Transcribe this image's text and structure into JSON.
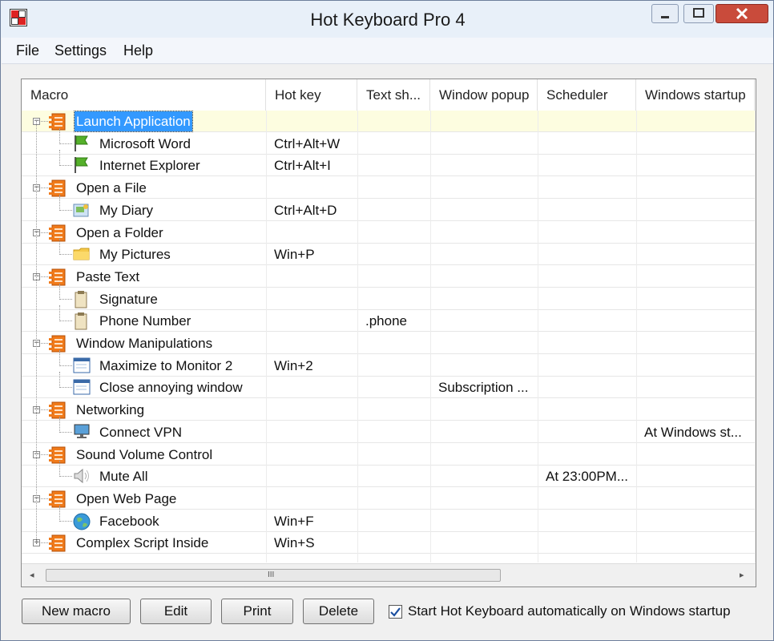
{
  "window": {
    "title": "Hot Keyboard Pro 4"
  },
  "menu": [
    "File",
    "Settings",
    "Help"
  ],
  "columns": [
    "Macro",
    "Hot key",
    "Text sh...",
    "Window popup",
    "Scheduler",
    "Windows startup"
  ],
  "rows": [
    {
      "level": 0,
      "label": "Launch Application",
      "icon": "folder-list-icon",
      "expander": "−",
      "selected": true,
      "hotkey": "",
      "text": "",
      "popup": "",
      "scheduler": "",
      "startup": ""
    },
    {
      "level": 1,
      "label": "Microsoft Word",
      "icon": "flag-icon",
      "hotkey": "Ctrl+Alt+W",
      "text": "",
      "popup": "",
      "scheduler": "",
      "startup": ""
    },
    {
      "level": 1,
      "label": "Internet Explorer",
      "icon": "flag-icon",
      "hotkey": "Ctrl+Alt+I",
      "text": "",
      "popup": "",
      "scheduler": "",
      "startup": ""
    },
    {
      "level": 0,
      "label": "Open a File",
      "icon": "folder-list-icon",
      "expander": "−",
      "hotkey": "",
      "text": "",
      "popup": "",
      "scheduler": "",
      "startup": ""
    },
    {
      "level": 1,
      "label": "My Diary",
      "icon": "document-icon",
      "hotkey": "Ctrl+Alt+D",
      "text": "",
      "popup": "",
      "scheduler": "",
      "startup": ""
    },
    {
      "level": 0,
      "label": "Open a Folder",
      "icon": "folder-list-icon",
      "expander": "−",
      "hotkey": "",
      "text": "",
      "popup": "",
      "scheduler": "",
      "startup": ""
    },
    {
      "level": 1,
      "label": "My Pictures",
      "icon": "folder-icon",
      "hotkey": "Win+P",
      "text": "",
      "popup": "",
      "scheduler": "",
      "startup": ""
    },
    {
      "level": 0,
      "label": "Paste Text",
      "icon": "folder-list-icon",
      "expander": "−",
      "hotkey": "",
      "text": "",
      "popup": "",
      "scheduler": "",
      "startup": ""
    },
    {
      "level": 1,
      "label": "Signature",
      "icon": "clipboard-icon",
      "hotkey": "",
      "text": "",
      "popup": "",
      "scheduler": "",
      "startup": ""
    },
    {
      "level": 1,
      "label": "Phone Number",
      "icon": "clipboard-icon",
      "hotkey": "",
      "text": ".phone",
      "popup": "",
      "scheduler": "",
      "startup": ""
    },
    {
      "level": 0,
      "label": "Window Manipulations",
      "icon": "folder-list-icon",
      "expander": "−",
      "hotkey": "",
      "text": "",
      "popup": "",
      "scheduler": "",
      "startup": ""
    },
    {
      "level": 1,
      "label": "Maximize to Monitor 2",
      "icon": "window-icon",
      "hotkey": "Win+2",
      "text": "",
      "popup": "",
      "scheduler": "",
      "startup": ""
    },
    {
      "level": 1,
      "label": "Close annoying window",
      "icon": "window-icon",
      "hotkey": "",
      "text": "",
      "popup": "Subscription ...",
      "scheduler": "",
      "startup": ""
    },
    {
      "level": 0,
      "label": "Networking",
      "icon": "folder-list-icon",
      "expander": "−",
      "hotkey": "",
      "text": "",
      "popup": "",
      "scheduler": "",
      "startup": ""
    },
    {
      "level": 1,
      "label": "Connect VPN",
      "icon": "monitor-icon",
      "hotkey": "",
      "text": "",
      "popup": "",
      "scheduler": "",
      "startup": "At Windows st..."
    },
    {
      "level": 0,
      "label": "Sound Volume Control",
      "icon": "folder-list-icon",
      "expander": "−",
      "hotkey": "",
      "text": "",
      "popup": "",
      "scheduler": "",
      "startup": ""
    },
    {
      "level": 1,
      "label": "Mute All",
      "icon": "speaker-icon",
      "hotkey": "",
      "text": "",
      "popup": "",
      "scheduler": "At 23:00PM...",
      "startup": ""
    },
    {
      "level": 0,
      "label": "Open Web Page",
      "icon": "folder-list-icon",
      "expander": "−",
      "hotkey": "",
      "text": "",
      "popup": "",
      "scheduler": "",
      "startup": ""
    },
    {
      "level": 1,
      "label": "Facebook",
      "icon": "globe-icon",
      "hotkey": "Win+F",
      "text": "",
      "popup": "",
      "scheduler": "",
      "startup": ""
    },
    {
      "level": 0,
      "label": "Complex Script Inside",
      "icon": "folder-list-icon",
      "expander": "+",
      "hotkey": "Win+S",
      "text": "",
      "popup": "",
      "scheduler": "",
      "startup": ""
    }
  ],
  "scrollbar": {
    "grip": "III",
    "left_arrow": "◂",
    "right_arrow": "▸"
  },
  "buttons": {
    "new_macro": "New macro",
    "edit": "Edit",
    "print": "Print",
    "delete": "Delete"
  },
  "startup_checkbox": {
    "label": "Start Hot Keyboard automatically on Windows startup",
    "checked": true,
    "mark": "✓"
  },
  "colors": {
    "selection": "#3399ff",
    "close_button": "#c94b3b",
    "folder_icon": "#f07a1a"
  }
}
